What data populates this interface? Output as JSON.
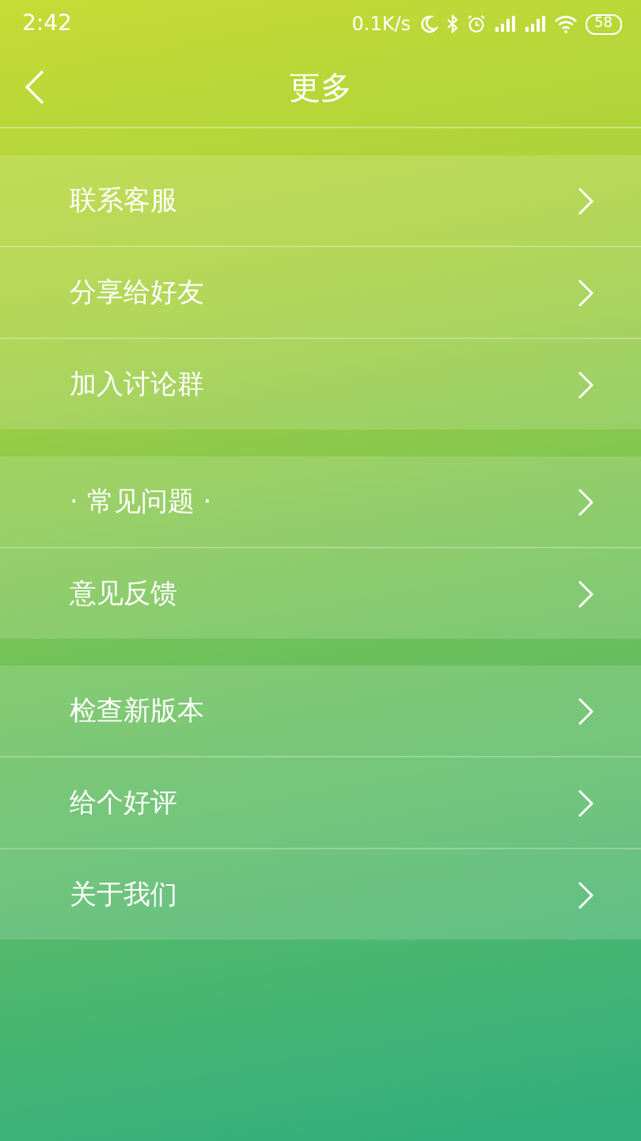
{
  "status_bar": {
    "time": "2:42",
    "network_speed": "0.1K/s",
    "battery": "58"
  },
  "header": {
    "title": "更多"
  },
  "groups": [
    {
      "items": [
        {
          "label": "联系客服"
        },
        {
          "label": "分享给好友"
        },
        {
          "label": "加入讨论群"
        }
      ]
    },
    {
      "items": [
        {
          "label": "· 常见问题 ·"
        },
        {
          "label": "意见反馈"
        }
      ]
    },
    {
      "items": [
        {
          "label": "检查新版本"
        },
        {
          "label": "给个好评"
        },
        {
          "label": "关于我们"
        }
      ]
    }
  ]
}
